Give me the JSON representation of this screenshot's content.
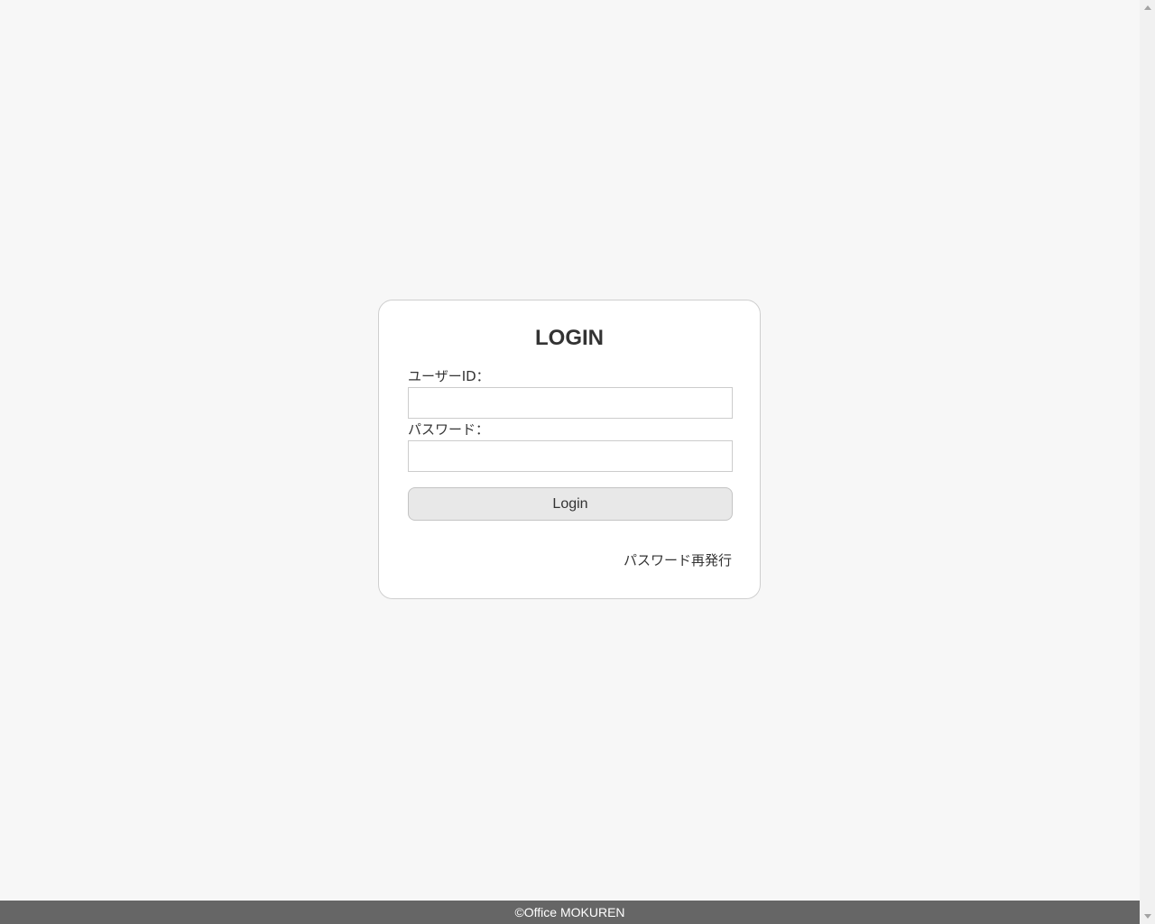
{
  "login_form": {
    "title": "LOGIN",
    "userid_label": "ユーザーID：",
    "userid_value": "",
    "password_label": "パスワード：",
    "password_value": "",
    "login_button_label": "Login",
    "reissue_link_label": "パスワード再発行"
  },
  "footer": {
    "copyright": "©Office MOKUREN"
  },
  "scrollbar": {
    "up_icon": "arrow-up-icon",
    "down_icon": "arrow-down-icon"
  }
}
